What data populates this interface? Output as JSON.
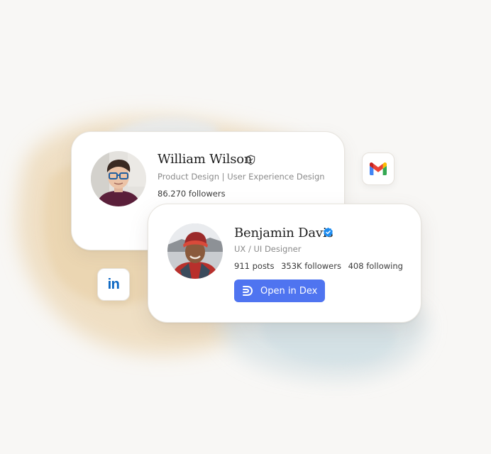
{
  "cards": {
    "william": {
      "name": "William Wilson",
      "subtitle": "Product Design | User Experience Design",
      "followers": "86.270 followers",
      "badge_icon": "shield-check-icon"
    },
    "benjamin": {
      "name": "Benjamin Davis",
      "subtitle": "UX / UI Designer",
      "posts": "911 posts",
      "followers": "353K followers",
      "following": "408 following",
      "badge_icon": "verified-check-icon",
      "button_label": "Open in Dex",
      "button_icon": "dex-logo-icon"
    }
  },
  "apps": {
    "gmail": {
      "icon": "gmail-icon"
    },
    "linkedin": {
      "icon": "linkedin-icon",
      "label": "in"
    }
  },
  "colors": {
    "background": "#f8f7f5",
    "button": "#4f74f0",
    "verified": "#1d8cf0",
    "linkedin": "#0a66c2"
  }
}
